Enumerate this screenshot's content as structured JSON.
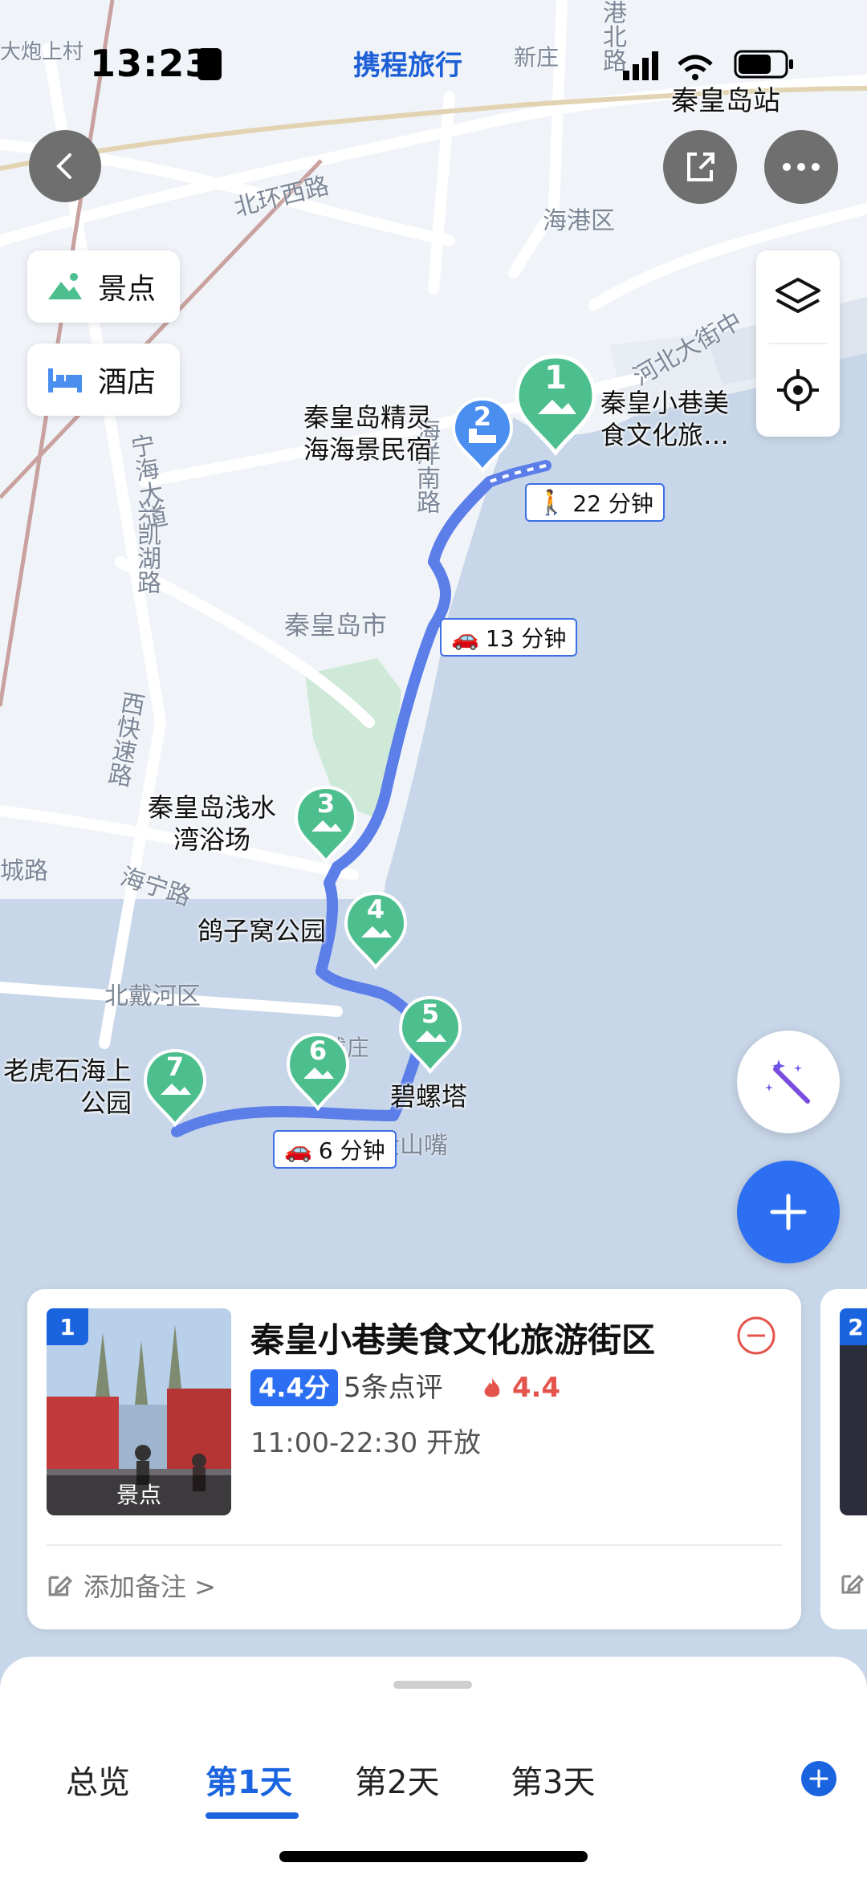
{
  "status_bar": {
    "time": "13:23",
    "brand": "携程旅行"
  },
  "map": {
    "labels": {
      "station": "秦皇岛站",
      "district_haigang": "海港区",
      "city": "秦皇岛市",
      "district_beidaihe": "北戴河区",
      "village": "大炮上村",
      "new_village": "新庄",
      "jinshanzui": "金山嘴",
      "zhuang": "戴庄"
    },
    "roads": {
      "beihuan": "北环西路",
      "hebei_street": "河北大街中",
      "haigang_north": "港北路",
      "haiyang": "海洋南路",
      "ninghai": "宁海大道",
      "xingkai": "兴凯湖路",
      "xikuai": "西快速路",
      "haining": "海宁路",
      "cheng": "城路"
    },
    "pois": [
      {
        "num": "1",
        "name_line1": "秦皇小巷美",
        "name_line2": "食文化旅…",
        "type": "sight"
      },
      {
        "num": "2",
        "name_line1": "秦皇岛精灵",
        "name_line2": "海海景民宿",
        "type": "hotel"
      },
      {
        "num": "3",
        "name_line1": "秦皇岛浅水",
        "name_line2": "湾浴场",
        "type": "sight"
      },
      {
        "num": "4",
        "name_line1": "鸽子窝公园",
        "name_line2": "",
        "type": "sight"
      },
      {
        "num": "5",
        "name_line1": "碧螺塔",
        "name_line2": "",
        "type": "sight"
      },
      {
        "num": "6",
        "name_line1": "",
        "name_line2": "",
        "type": "sight"
      },
      {
        "num": "7",
        "name_line1": "老虎石海上",
        "name_line2": "公园",
        "type": "sight"
      }
    ],
    "travel_times": {
      "walk": "22 分钟",
      "drive1": "13 分钟",
      "drive2": "6 分钟"
    }
  },
  "filters": {
    "sights": "景点",
    "hotels": "酒店"
  },
  "poi_card": {
    "index": "1",
    "category": "景点",
    "title": "秦皇小巷美食文化旅游街区",
    "score": "4.4分",
    "reviews": "5条点评",
    "heat": "4.4",
    "hours": "11:00-22:30 开放",
    "note": "添加备注 >",
    "next_index": "2"
  },
  "tabs": [
    "总览",
    "第1天",
    "第2天",
    "第3天"
  ],
  "active_tab": 1,
  "colors": {
    "accent": "#1b64e0",
    "sight_pin": "#4dbf8e",
    "hotel_pin": "#4a8ff0",
    "route": "#5b7ee8",
    "heat": "#e4534c"
  }
}
